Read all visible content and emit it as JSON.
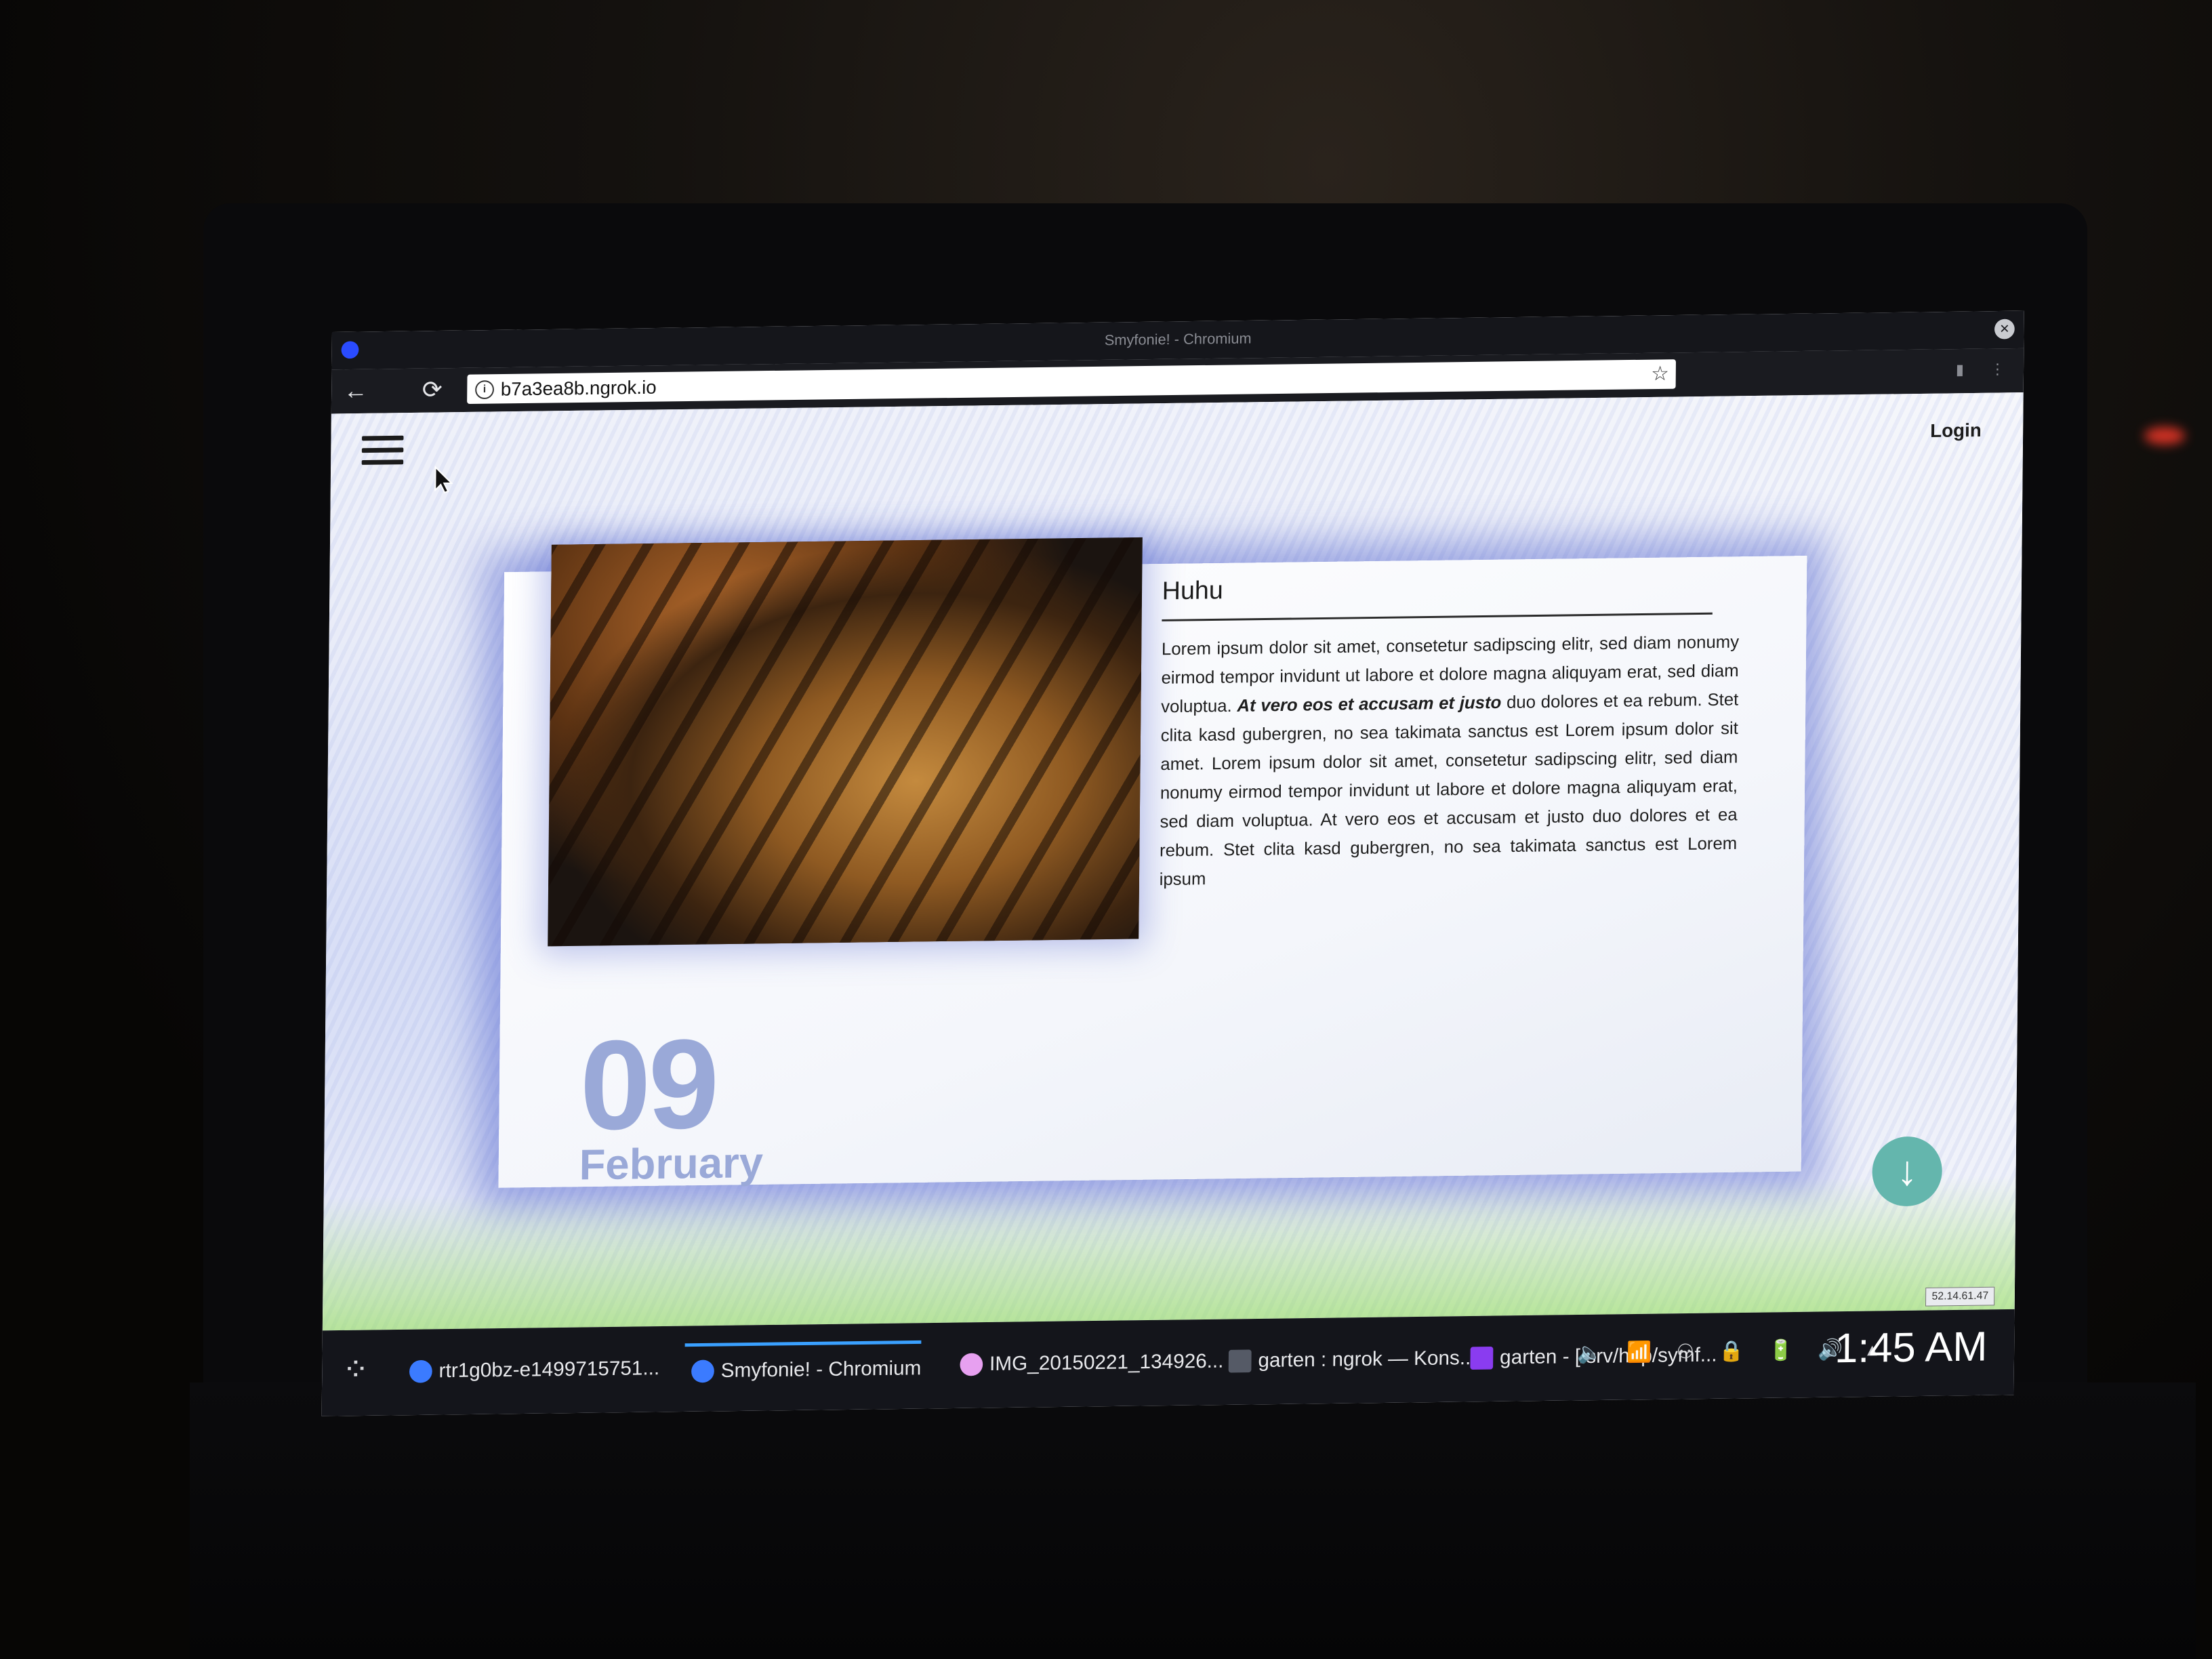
{
  "window": {
    "title": "Smyfonie! - Chromium",
    "close_glyph": "×"
  },
  "browser": {
    "url": "b7a3ea8b.ngrok.io",
    "back_glyph": "←",
    "reload_glyph": "⟳",
    "star_glyph": "☆",
    "info_glyph": "i"
  },
  "page": {
    "login_label": "Login",
    "article": {
      "title": "Huhu",
      "body_part1": "Lorem ipsum dolor sit amet, consetetur sadipscing elitr, sed diam nonumy eirmod tempor invidunt ut labore et dolore magna aliquyam erat, sed diam voluptua. ",
      "body_bold": "At vero eos et accusam et justo",
      "body_part2": " duo dolores et ea rebum. Stet clita kasd gubergren, no sea takimata sanctus est Lorem ipsum dolor sit amet. Lorem ipsum dolor sit amet, consetetur sadipscing elitr, sed diam nonumy eirmod tempor invidunt ut labore et dolore magna aliquyam erat, sed diam voluptua. At vero eos et accusam et justo duo dolores et ea rebum. Stet clita kasd gubergren, no sea takimata sanctus est Lorem ipsum"
    },
    "date": {
      "day": "09",
      "month": "February"
    },
    "scroll_glyph": "↓"
  },
  "taskbar": {
    "launcher_glyph": "⁘",
    "tasks": [
      {
        "label": "rtr1g0bz-e1499715751...",
        "icon_color": "#3b7bff"
      },
      {
        "label": "Smyfonie! - Chromium",
        "icon_color": "#3b7bff"
      },
      {
        "label": "IMG_20150221_134926...",
        "icon_color": "#e7a0f0"
      },
      {
        "label": "garten : ngrok — Kons...",
        "icon_color": "#555a66"
      },
      {
        "label": "garten - [/srv/http/symf...",
        "icon_color": "#8a3cf0"
      }
    ],
    "tray_icons": "🔈 📶 ⚇ 🔒 🔋 🔊 ▴",
    "ip": "52.14.61.47",
    "clock": "1:45 AM"
  }
}
